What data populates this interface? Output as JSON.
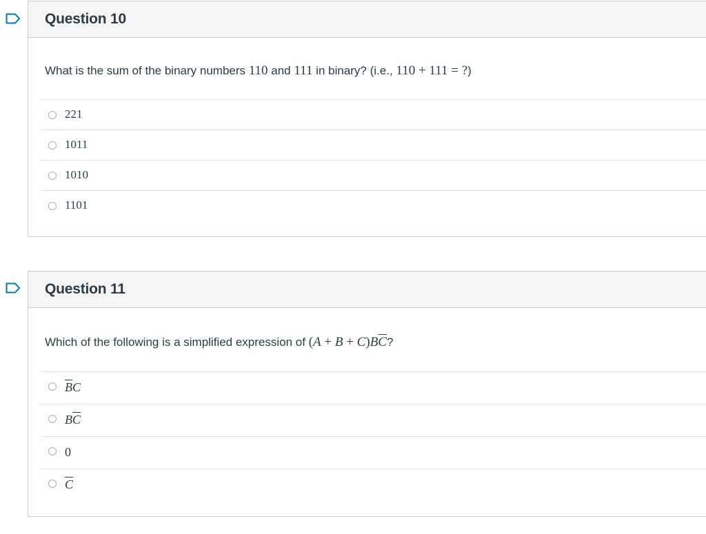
{
  "questions": [
    {
      "title": "Question 10",
      "text": {
        "pre": "What is the sum of the binary numbers ",
        "n1": "110",
        "mid1": " and ",
        "n2": "111",
        "mid2": " in binary? (i.e., ",
        "expr": "110 + 111 =  ?",
        "post": ")"
      },
      "answers": [
        "221",
        "1011",
        "1010",
        "1101"
      ]
    },
    {
      "title": "Question 11",
      "text": {
        "pre": "Which of the following is a simplified expression of ",
        "expr_open": "(",
        "A": "A",
        "plus1": " + ",
        "B": "B",
        "plus2": " + ",
        "C": "C",
        "expr_close": ")",
        "B2": "B",
        "C2": "C",
        "post": "?"
      },
      "answers": [
        {
          "bar": "B",
          "rest": "C"
        },
        {
          "plain": "B",
          "bar": "C"
        },
        {
          "plain": "0"
        },
        {
          "bar": "C"
        }
      ]
    }
  ],
  "icons": {
    "flag": "flag-question-icon",
    "radio": "radio-unselected-icon"
  },
  "colors": {
    "flag": "#0374b5",
    "header_bg": "#f5f5f5",
    "border": "#c7cdd1",
    "text": "#2d3b45"
  }
}
